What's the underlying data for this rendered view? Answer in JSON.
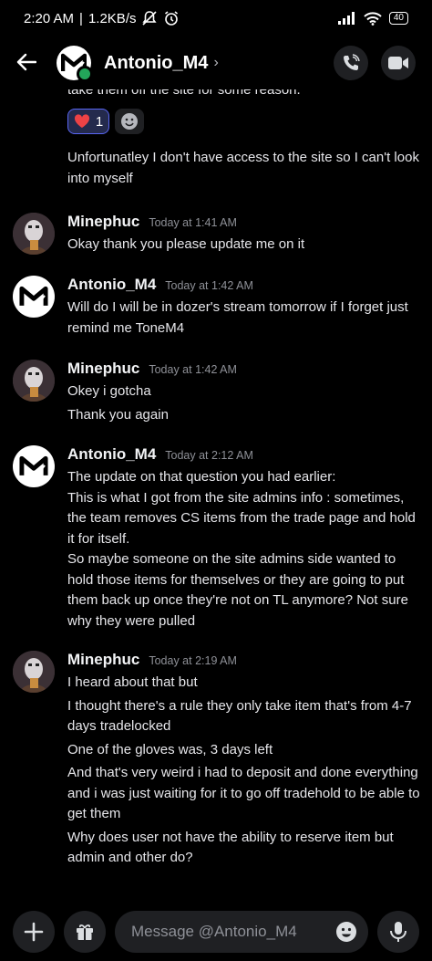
{
  "status": {
    "time": "2:20 AM",
    "speed": "1.2KB/s",
    "battery": "40"
  },
  "header": {
    "back_icon": "arrow-left-icon",
    "name": "Antonio_M4",
    "chevron": "›",
    "call_icon": "phone-icon",
    "video_icon": "video-camera-icon"
  },
  "cut_message": {
    "text": "take them off the site for some reason."
  },
  "reactions": {
    "heart_count": "1"
  },
  "continuation": {
    "text": "Unfortunatley I don't have access to the site so I can't look into myself"
  },
  "groups": [
    {
      "name": "Minephuc",
      "time": "Today at 1:41 AM",
      "lines": [
        "Okay thank you please update me on it"
      ]
    },
    {
      "name": "Antonio_M4",
      "time": "Today at 1:42 AM",
      "lines": [
        "Will do I will be in dozer's stream tomorrow if I forget just remind me ToneM4"
      ]
    },
    {
      "name": "Minephuc",
      "time": "Today at 1:42 AM",
      "lines": [
        "Okey i gotcha",
        "Thank you again"
      ]
    },
    {
      "name": "Antonio_M4",
      "time": "Today at 2:12 AM",
      "lines": [
        "The update on that question you had earlier:",
        "This is what I got from the site admins info : sometimes, the team removes CS items from the trade page and hold it for itself.",
        "So maybe someone on the site admins side wanted to hold those items for themselves or they are going to put them back up once they're not on TL anymore? Not sure why they were pulled"
      ]
    },
    {
      "name": "Minephuc",
      "time": "Today at 2:19 AM",
      "lines": [
        "I heard about that but",
        "I thought there's a rule they only take item that's from 4-7 days tradelocked",
        "One of the gloves was, 3 days left",
        "And that's very weird i had to deposit and done everything and i was just waiting for it to go off tradehold to be able to get them",
        "Why does user not have the ability to reserve item but admin and other do?"
      ]
    }
  ],
  "composer": {
    "placeholder": "Message @Antonio_M4"
  },
  "colors": {
    "background": "#000000",
    "surface": "#1f2023",
    "online": "#23a55a",
    "heart": "#ed4245"
  }
}
